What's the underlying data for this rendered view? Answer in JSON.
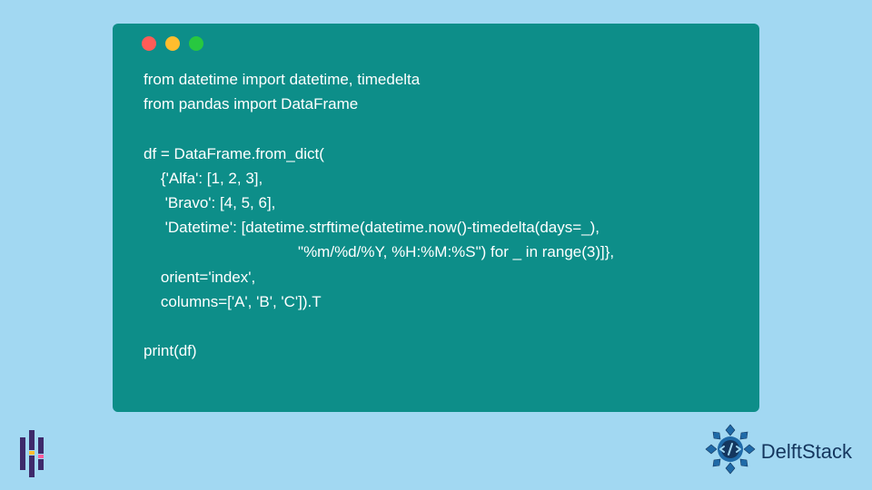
{
  "code": {
    "lines": [
      "from datetime import datetime, timedelta",
      "from pandas import DataFrame",
      "",
      "df = DataFrame.from_dict(",
      "    {'Alfa': [1, 2, 3],",
      "     'Bravo': [4, 5, 6],",
      "     'Datetime': [datetime.strftime(datetime.now()-timedelta(days=_),",
      "                                    \"%m/%d/%Y, %H:%M:%S\") for _ in range(3)]},",
      "    orient='index',",
      "    columns=['A', 'B', 'C']).T",
      "",
      "print(df)"
    ]
  },
  "branding": {
    "right_text": "DelftStack"
  },
  "colors": {
    "page_bg": "#a2d8f2",
    "window_bg": "#0d8e89",
    "brand_blue": "#14365e",
    "brand_purple": "#3e2a6b",
    "brand_yellow": "#ffbd2e",
    "brand_pink": "#ff5c9d"
  }
}
